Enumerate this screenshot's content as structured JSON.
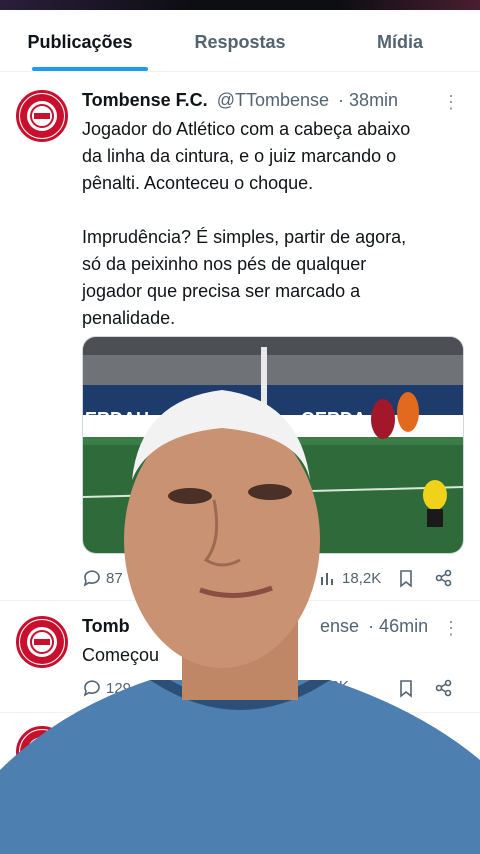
{
  "tabs": [
    {
      "label": "Publicações",
      "active": true
    },
    {
      "label": "Respostas",
      "active": false
    },
    {
      "label": "Mídia",
      "active": false
    }
  ],
  "posts": [
    {
      "name": "Tombense F.C.",
      "handle": "@TTombense",
      "time": "· 38min",
      "text_lines": [
        "Jogador do Atlético com a cabeça abaixo",
        "da linha da cintura, e o juiz marcando o",
        "pênalti. Aconteceu o choque.",
        "",
        "Imprudência? É simples, partir de agora,",
        "só da peixinho nos pés de qualquer",
        "jogador que precisa ser marcado a",
        "penalidade."
      ],
      "media": {
        "board_left": "ERDAU",
        "board_right": "GERDA"
      },
      "replies": "87",
      "views": "18,2K"
    },
    {
      "name": "Tomb",
      "handle": "ense",
      "time": "· 46min",
      "text": "Começou",
      "replies": "129",
      "views": "1,2K"
    }
  ],
  "colors": {
    "accent": "#1d9bf0",
    "club_red": "#c8102e",
    "muted": "#536471"
  }
}
